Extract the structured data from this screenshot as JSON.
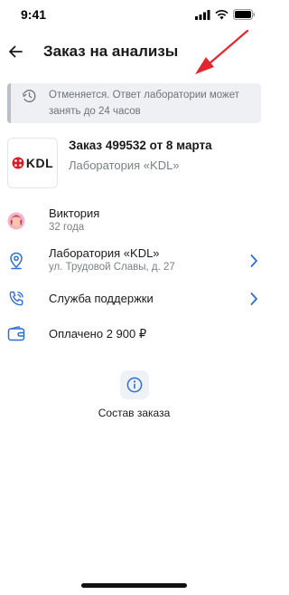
{
  "status_bar": {
    "time": "9:41"
  },
  "header": {
    "title": "Заказ на анализы"
  },
  "status_banner": {
    "text": "Отменяется. Ответ лаборатории может занять до 24 часов",
    "icon": "clock-icon"
  },
  "order": {
    "title": "Заказ 499532 от 8 марта",
    "lab_name": "Лаборатория «KDL»",
    "logo_text": "KDL"
  },
  "patient": {
    "name": "Виктория",
    "age": "32 года",
    "icon": "avatar"
  },
  "lab": {
    "title": "Лаборатория «KDL»",
    "address": "ул. Трудовой Славы, д. 27",
    "icon": "location-pin-icon"
  },
  "support": {
    "title": "Служба поддержки",
    "icon": "phone-icon"
  },
  "payment": {
    "text": "Оплачено 2 900 ₽",
    "icon": "wallet-icon"
  },
  "composition": {
    "label": "Состав заказа",
    "icon": "info-icon"
  },
  "colors": {
    "accent": "#2f6dd1",
    "banner_bg": "#eef0f3",
    "annotation_arrow": "#e3262d",
    "kdl_red": "#d5212c"
  }
}
